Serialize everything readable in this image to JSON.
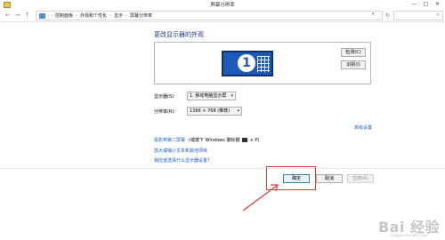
{
  "window": {
    "title": "屏幕分辨率",
    "controls": [
      "—",
      "□",
      "✕"
    ]
  },
  "addressbar": {
    "breadcrumbs": [
      "控制面板",
      "外观和个性化",
      "显示",
      "屏幕分辨率"
    ],
    "separator": "›",
    "dropdown_glyph": "▾",
    "refresh_glyph": "↻"
  },
  "main": {
    "page_title": "更改显示器的外观",
    "monitor_number": "1",
    "detect_button": "检测(C)",
    "identify_button": "识别(I)",
    "display_label": "显示器(S):",
    "display_value": "1. 移动电脑显示屏",
    "resolution_label": "分辨率(R):",
    "resolution_value": "1366 × 768 (推荐)",
    "advanced_link": "高级设置",
    "project_link": "投影到第二屏幕",
    "project_hint_prefix": "(或按下 Windows 徽标键",
    "project_hint_suffix": "+ P)",
    "enlarge_link": "放大或缩小文本和其他项目",
    "which_settings_link": "我应该选择什么显示器设置?"
  },
  "footer": {
    "ok_button": "确定",
    "cancel_button": "取消",
    "apply_button": "应用(A)"
  },
  "watermark": {
    "text": "Bai 经验",
    "sub": "jingyan.baidu.com"
  },
  "colors": {
    "link": "#1a5bc4",
    "title": "#1e3287",
    "highlight": "#e03a3a",
    "monitor": "#1e5ab8"
  }
}
